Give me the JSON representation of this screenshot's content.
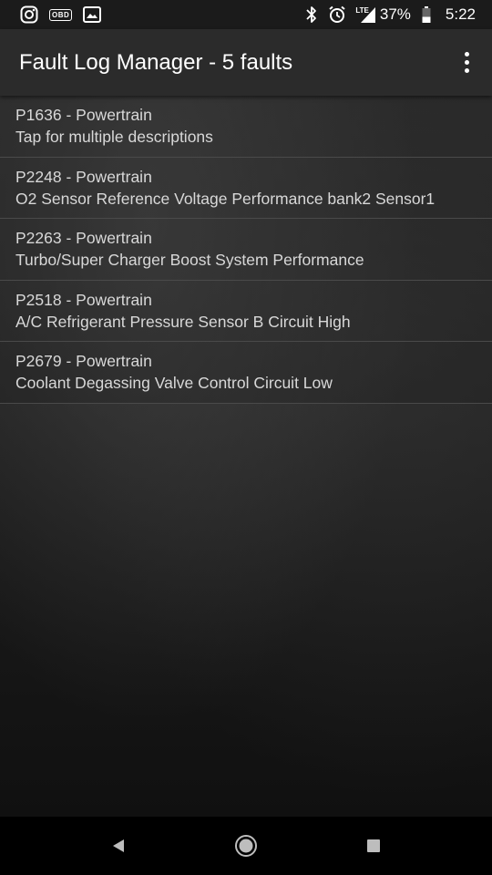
{
  "status_bar": {
    "left_icons": [
      "instagram-icon",
      "obd-icon",
      "image-gallery-icon"
    ],
    "obd_label": "OBD",
    "right_icons": [
      "bluetooth-icon",
      "alarm-icon",
      "lte-signal-icon",
      "battery-icon"
    ],
    "lte_label": "LTE",
    "battery_percent": "37%",
    "battery_level": 0.37,
    "time": "5:22"
  },
  "app_bar": {
    "title": "Fault Log Manager - 5 faults",
    "menu_icon": "more-vert-icon"
  },
  "faults": [
    {
      "code": "P1636 - Powertrain",
      "description": "Tap for multiple descriptions"
    },
    {
      "code": "P2248 - Powertrain",
      "description": "O2 Sensor Reference Voltage Performance bank2 Sensor1"
    },
    {
      "code": "P2263 - Powertrain",
      "description": "Turbo/Super Charger Boost System Performance"
    },
    {
      "code": "P2518 - Powertrain",
      "description": "A/C Refrigerant Pressure Sensor B Circuit High"
    },
    {
      "code": "P2679 - Powertrain",
      "description": "Coolant Degassing Valve Control Circuit Low"
    }
  ],
  "nav_bar": {
    "buttons": [
      "back-icon",
      "home-icon",
      "recents-icon"
    ]
  },
  "colors": {
    "status_bar_bg": "#1b1b1b",
    "app_bar_bg": "#2b2b2b",
    "text_primary": "#ffffff",
    "text_list": "#d8d8d8",
    "divider": "#4a4a4a",
    "nav_bar_bg": "#000000"
  }
}
